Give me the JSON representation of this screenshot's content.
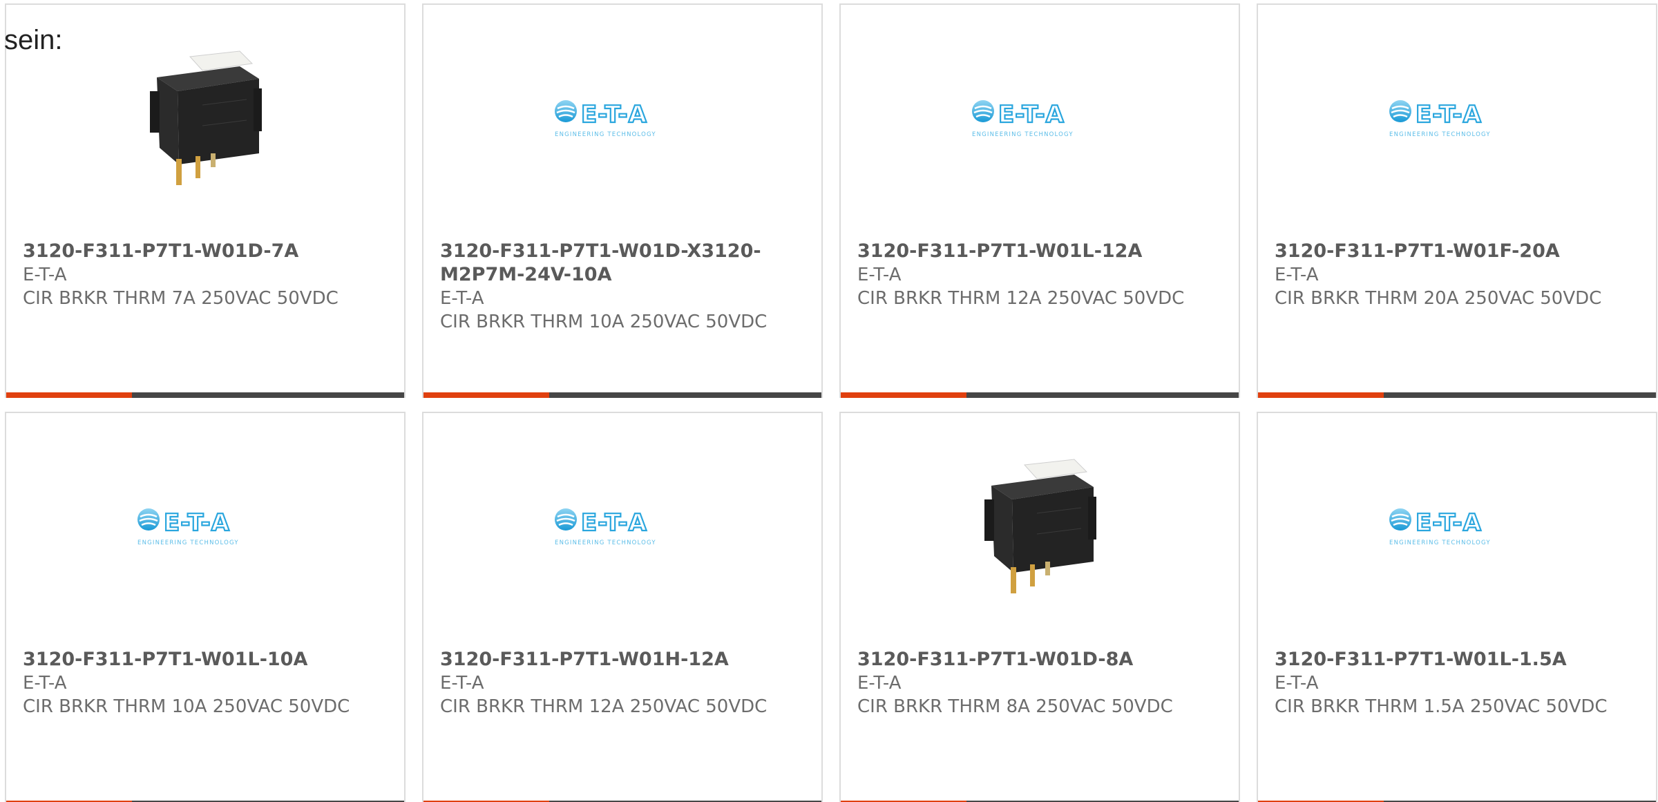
{
  "intro": {
    "text": "sein:"
  },
  "colors": {
    "accent": "#e0400f",
    "bar": "#464646",
    "border": "#dcdcdc",
    "text": "#6c6c6c"
  },
  "logo": {
    "wordmark": "E-T-A",
    "tagline": "ENGINEERING TECHNOLOGY"
  },
  "products": [
    {
      "part_number": "3120-F311-P7T1-W01D-7A",
      "manufacturer": "E-T-A",
      "description": "CIR BRKR THRM 7A 250VAC 50VDC",
      "image": "circuit-breaker-photo"
    },
    {
      "part_number": "3120-F311-P7T1-W01D-X3120-M2P7M-24V-10A",
      "manufacturer": "E-T-A",
      "description": "CIR BRKR THRM 10A 250VAC 50VDC",
      "image": "eta-logo"
    },
    {
      "part_number": "3120-F311-P7T1-W01L-12A",
      "manufacturer": "E-T-A",
      "description": "CIR BRKR THRM 12A 250VAC 50VDC",
      "image": "eta-logo"
    },
    {
      "part_number": "3120-F311-P7T1-W01F-20A",
      "manufacturer": "E-T-A",
      "description": "CIR BRKR THRM 20A 250VAC 50VDC",
      "image": "eta-logo"
    },
    {
      "part_number": "3120-F311-P7T1-W01L-10A",
      "manufacturer": "E-T-A",
      "description": "CIR BRKR THRM 10A 250VAC 50VDC",
      "image": "eta-logo"
    },
    {
      "part_number": "3120-F311-P7T1-W01H-12A",
      "manufacturer": "E-T-A",
      "description": "CIR BRKR THRM 12A 250VAC 50VDC",
      "image": "eta-logo"
    },
    {
      "part_number": "3120-F311-P7T1-W01D-8A",
      "manufacturer": "E-T-A",
      "description": "CIR BRKR THRM 8A 250VAC 50VDC",
      "image": "circuit-breaker-photo"
    },
    {
      "part_number": "3120-F311-P7T1-W01L-1.5A",
      "manufacturer": "E-T-A",
      "description": "CIR BRKR THRM 1.5A 250VAC 50VDC",
      "image": "eta-logo"
    }
  ]
}
